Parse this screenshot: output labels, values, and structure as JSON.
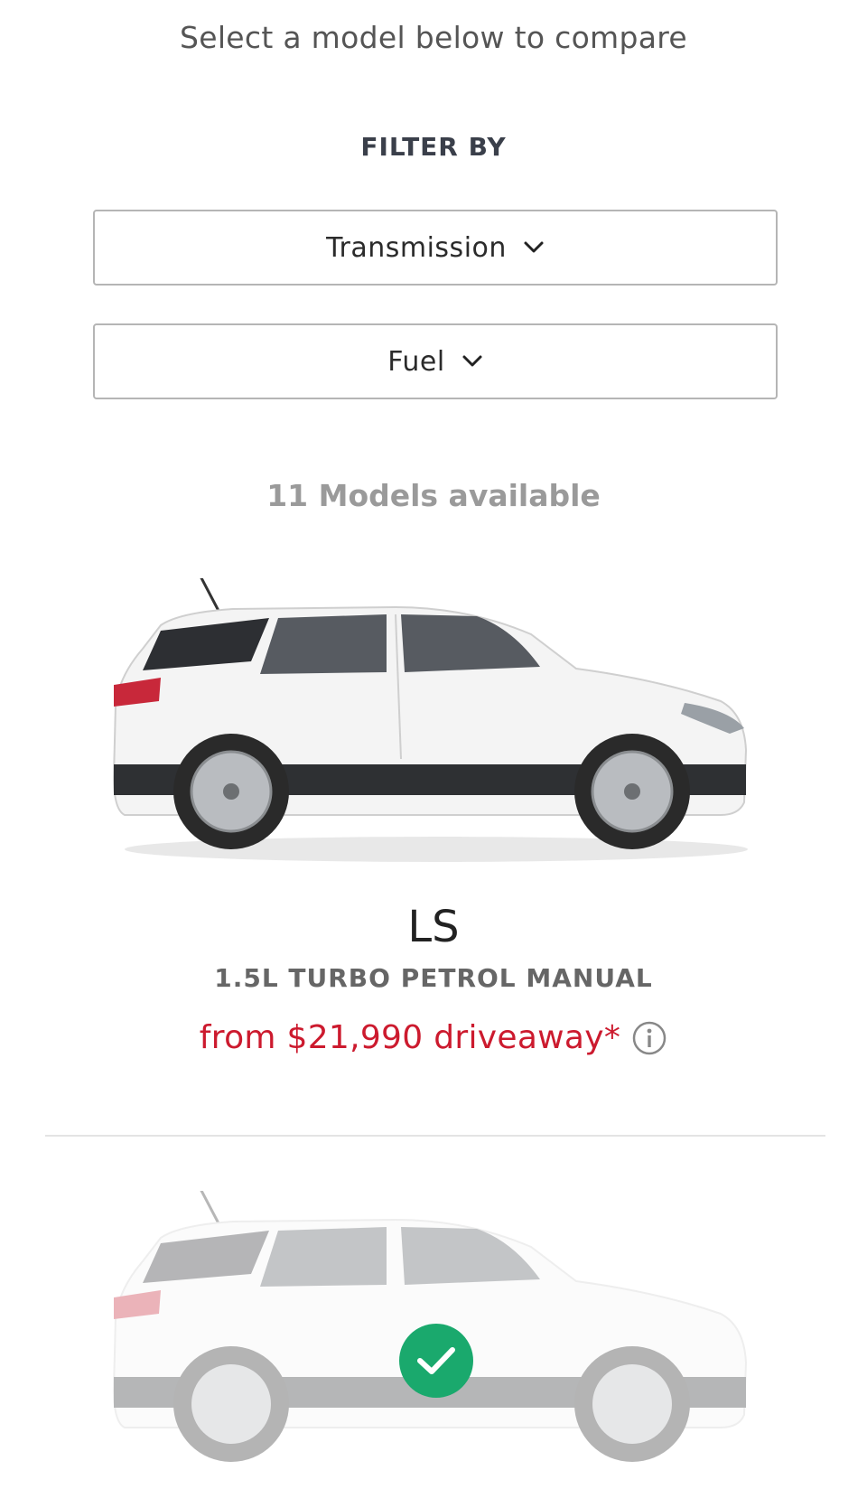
{
  "header": {
    "instruction": "Select a model below to compare",
    "filter_title": "FILTER BY"
  },
  "filters": {
    "transmission_label": "Transmission",
    "fuel_label": "Fuel"
  },
  "results": {
    "count_text": "11 Models available"
  },
  "models": [
    {
      "name": "LS",
      "spec": "1.5L TURBO PETROL MANUAL",
      "price": "from $21,990 driveaway*"
    }
  ],
  "colors": {
    "price_red": "#cc1a2e",
    "check_green": "#1aa96d"
  }
}
